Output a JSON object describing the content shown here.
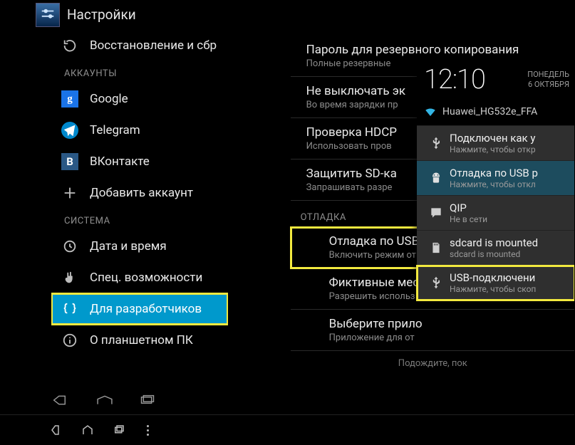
{
  "title": "Настройки",
  "sidebar": {
    "top_item": {
      "label": "Восстановление и сбр"
    },
    "accounts_header": "АККАУНТЫ",
    "accounts": [
      {
        "label": "Google"
      },
      {
        "label": "Telegram"
      },
      {
        "label": "ВКонтакте"
      },
      {
        "label": "Добавить аккаунт"
      }
    ],
    "system_header": "СИСТЕМА",
    "system": [
      {
        "label": "Дата и время"
      },
      {
        "label": "Спец. возможности"
      },
      {
        "label": "Для разработчиков"
      },
      {
        "label": "О планшетном ПК"
      }
    ]
  },
  "panel": {
    "rows_top": [
      {
        "t": "Пароль для резервного копирования",
        "s": "Полные резервные"
      },
      {
        "t": "Не выключать эк",
        "s": "Во время зарядки пр"
      },
      {
        "t": "Проверка HDCP",
        "s": "Использовать пров"
      },
      {
        "t": "Защитить SD-ка",
        "s": "Запрашивать разре"
      }
    ],
    "debug_header": "ОТЛАДКА",
    "rows_debug": [
      {
        "t": "Отладка по USB",
        "s": "Включить режим от"
      },
      {
        "t": "Фиктивные мест",
        "s": "Разрешить использ"
      },
      {
        "t": "Выберите прило",
        "s": "Приложение для от"
      }
    ],
    "footer_hint": "Подождите, пок"
  },
  "shade": {
    "time": "12:10",
    "day": "ПОНЕДЕЛЬ",
    "date": "6 ОКТЯБРЯ",
    "wifi": "Huawei_HG532e_FFA",
    "items": [
      {
        "t": "Подключен как у",
        "s": "Нажмите, чтобы откр"
      },
      {
        "t": "Отладка по USB р",
        "s": "Нажмите, чтобы откл"
      },
      {
        "t": "QIP",
        "s": "Не в сети"
      },
      {
        "t": "sdcard is mounted",
        "s": "sdcard is mounted"
      },
      {
        "t": "USB-подключени",
        "s": "Нажмите, чтобы скоп"
      }
    ]
  }
}
